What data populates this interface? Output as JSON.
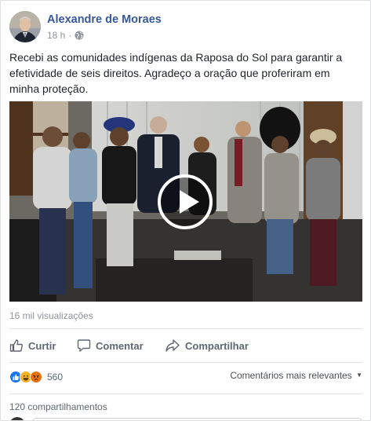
{
  "post": {
    "author": "Alexandre de Moraes",
    "time": "18 h",
    "separator": "·",
    "privacy_icon": "globe-icon",
    "text": "Recebi as comunidades indígenas da Raposa do Sol para garantir a efetividade de seis direitos. Agradeço a oração que proferiram em minha proteção.",
    "views": "16 mil visualizações"
  },
  "actions": {
    "like": "Curtir",
    "comment": "Comentar",
    "share": "Compartilhar"
  },
  "reactions": {
    "icons": [
      "like-icon",
      "haha-icon",
      "angry-icon"
    ],
    "count": "560",
    "sort_label": "Comentários mais relevantes"
  },
  "shares": "120 compartilhamentos",
  "colors": {
    "author": "#365899",
    "meta": "#90949c",
    "like": "#1877f2",
    "haha": "#f7b125",
    "angry": "#e9710f"
  }
}
